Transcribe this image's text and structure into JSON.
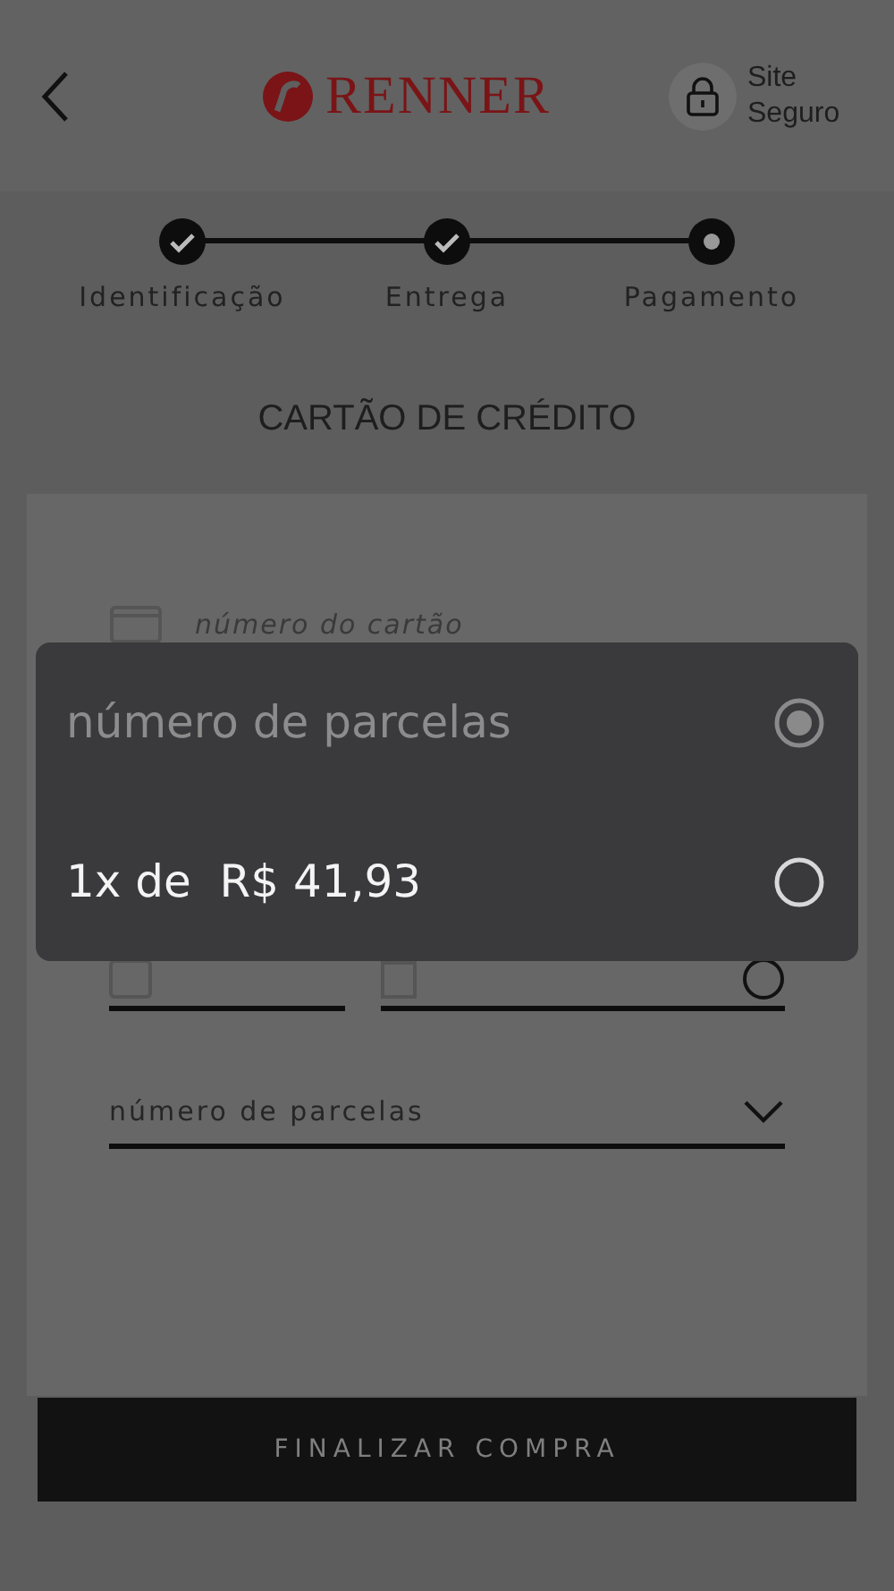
{
  "header": {
    "brand": "RENNER",
    "secure_badge": "Site Seguro"
  },
  "steps": [
    {
      "label": "Identificação",
      "completed": true
    },
    {
      "label": "Entrega",
      "completed": true
    },
    {
      "label": "Pagamento",
      "completed": false
    }
  ],
  "section_title": "CARTÃO DE CRÉDITO",
  "form": {
    "card_number": {
      "placeholder": "número do cartão"
    },
    "installments": {
      "placeholder": "número de parcelas"
    }
  },
  "submit_button": "FINALIZAR COMPRA",
  "picker": {
    "options": [
      {
        "label": "número de parcelas",
        "selected": true,
        "disabled": true
      },
      {
        "label": "1x de  R$ 41,93",
        "selected": false,
        "disabled": false
      }
    ]
  }
}
